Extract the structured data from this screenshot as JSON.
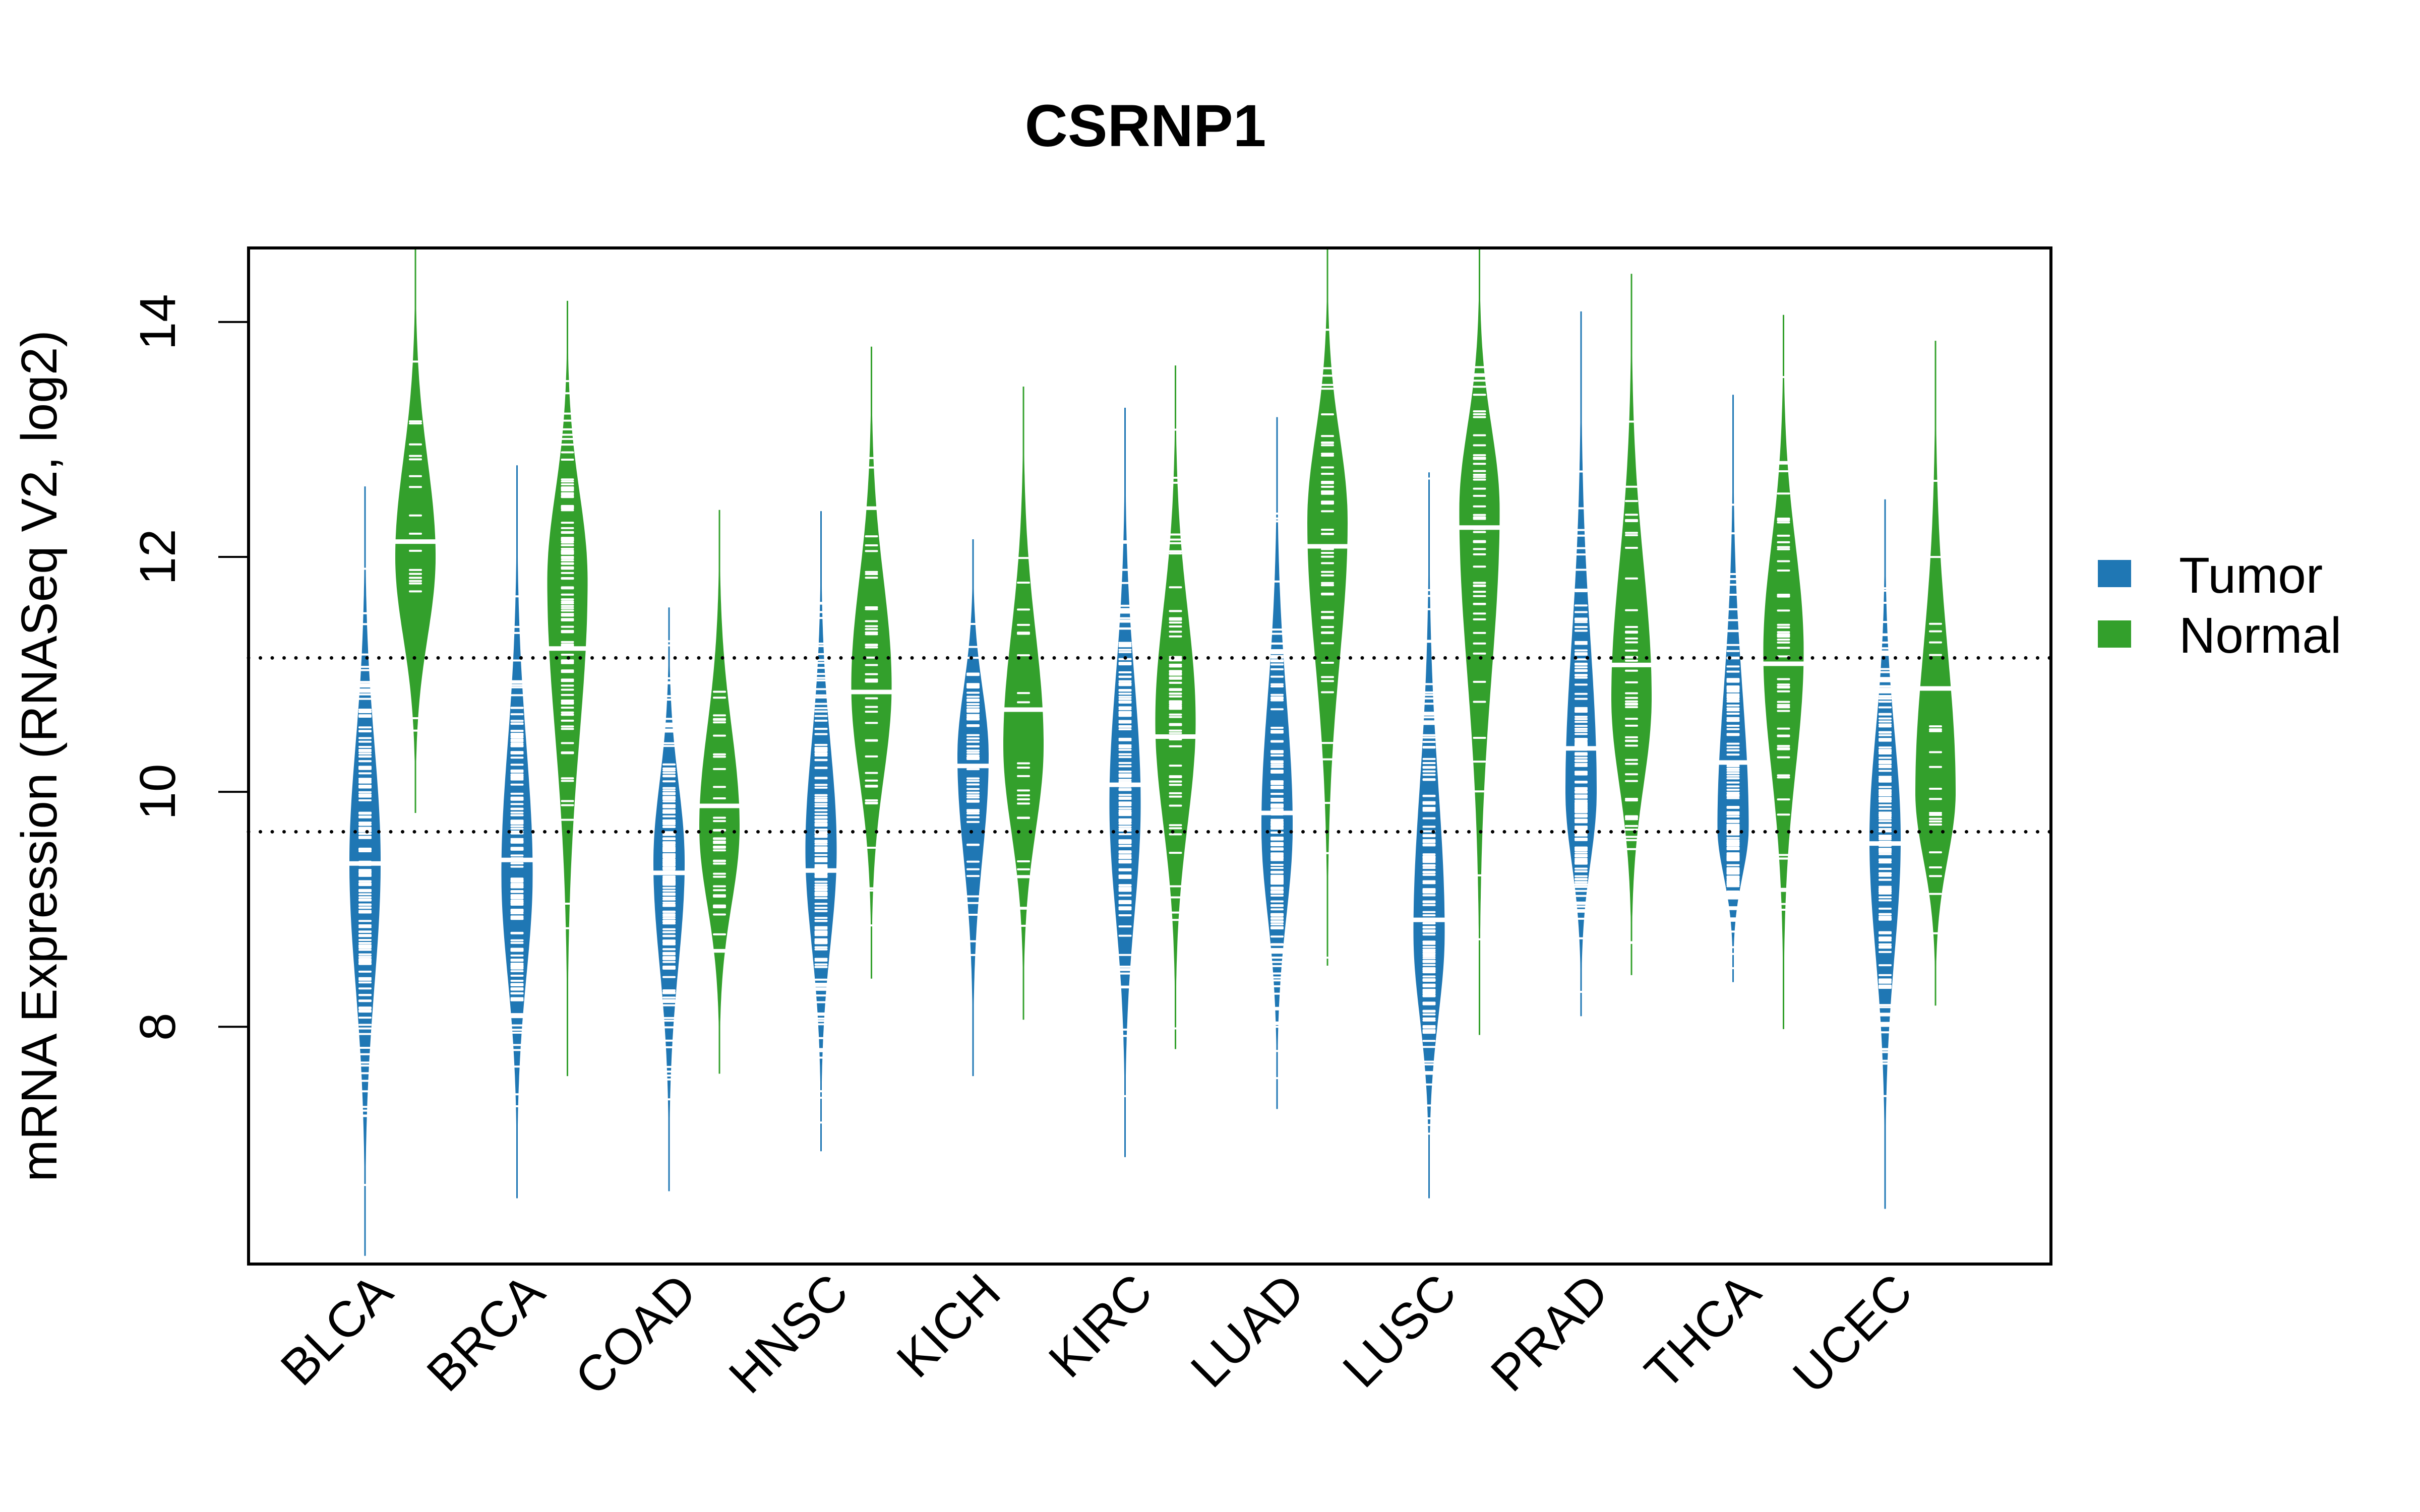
{
  "chart_data": {
    "type": "violin",
    "title": "CSRNP1",
    "xlabel": "",
    "ylabel": "mRNA Expression (RNASeq V2, log2)",
    "ylim": [
      5.98,
      14.63
    ],
    "yticks": [
      8,
      10,
      12,
      14
    ],
    "grid": false,
    "reference_lines": [
      {
        "style": "dotted",
        "value": 11.14
      },
      {
        "style": "dotted",
        "value": 9.66
      }
    ],
    "categories": [
      "BLCA",
      "BRCA",
      "COAD",
      "HNSC",
      "KICH",
      "KIRC",
      "LUAD",
      "LUSC",
      "PRAD",
      "THCA",
      "UCEC"
    ],
    "legend": {
      "placement": "right",
      "entries": [
        {
          "name": "Tumor",
          "color": "#1f77b4"
        },
        {
          "name": "Normal",
          "color": "#33a02c"
        }
      ]
    },
    "series": [
      {
        "name": "Tumor",
        "color": "#1f77b4",
        "median": [
          9.39,
          9.42,
          9.31,
          9.33,
          10.22,
          10.06,
          9.82,
          8.91,
          10.37,
          10.25,
          9.56
        ],
        "mode": [
          9.4,
          9.3,
          9.4,
          9.5,
          10.3,
          9.9,
          9.7,
          8.8,
          10.0,
          9.7,
          9.6
        ],
        "min": [
          6.05,
          6.54,
          6.6,
          6.94,
          7.58,
          6.89,
          7.3,
          6.54,
          8.09,
          8.38,
          6.45
        ],
        "max": [
          12.6,
          12.78,
          11.57,
          12.39,
          12.15,
          13.27,
          13.19,
          12.72,
          14.09,
          13.38,
          12.49
        ],
        "n_points": [
          400,
          1100,
          290,
          520,
          66,
          530,
          520,
          500,
          500,
          510,
          550
        ]
      },
      {
        "name": "Normal",
        "color": "#33a02c",
        "median": [
          12.13,
          11.22,
          9.88,
          10.85,
          10.7,
          10.47,
          12.09,
          12.25,
          11.08,
          11.09,
          10.88
        ],
        "mode": [
          12.0,
          11.8,
          9.7,
          10.9,
          10.4,
          10.6,
          12.3,
          12.4,
          10.8,
          11.2,
          10.0
        ],
        "min": [
          9.82,
          7.58,
          7.6,
          8.41,
          8.06,
          7.81,
          8.52,
          7.93,
          8.44,
          7.98,
          8.18
        ],
        "max": [
          14.63,
          14.18,
          12.4,
          13.79,
          13.45,
          13.63,
          14.63,
          14.63,
          14.41,
          14.06,
          13.84
        ],
        "n_points": [
          19,
          112,
          41,
          44,
          25,
          72,
          58,
          51,
          52,
          59,
          23
        ]
      }
    ]
  }
}
